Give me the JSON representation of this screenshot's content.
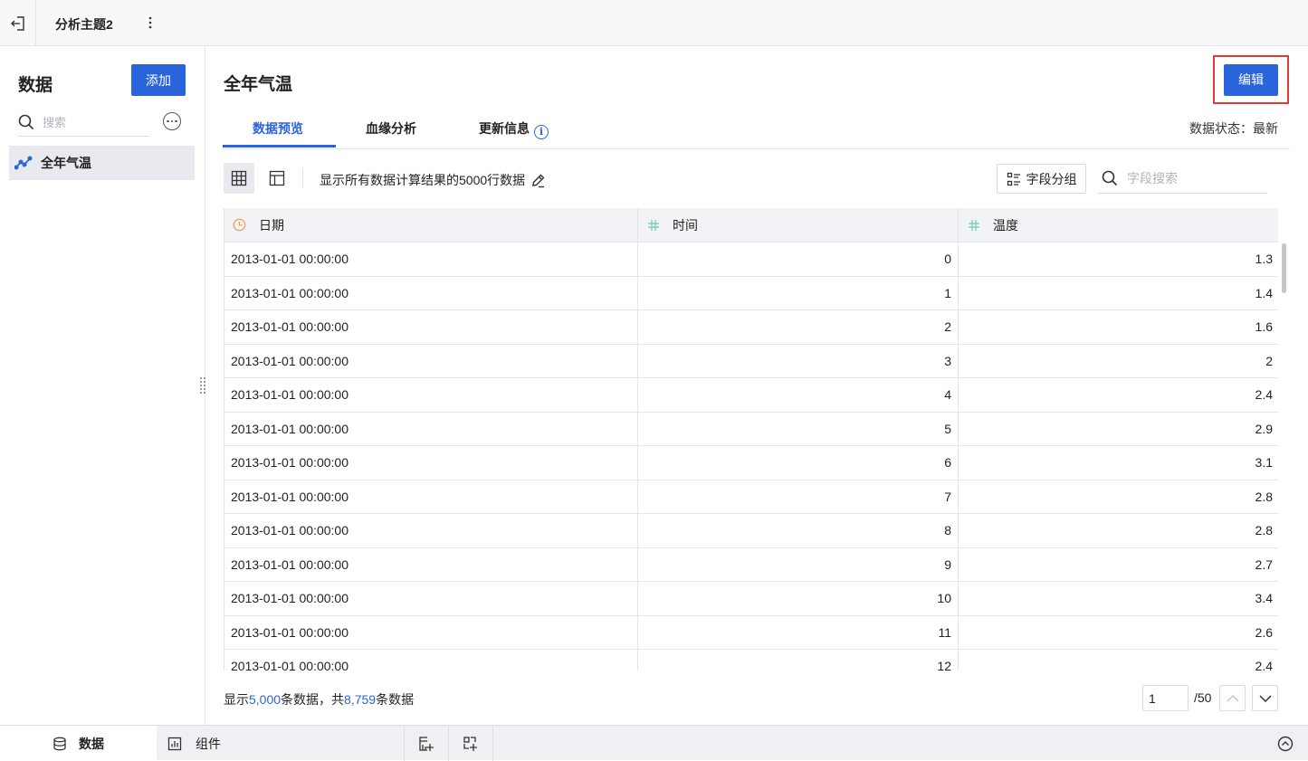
{
  "topbar": {
    "title": "分析主题2"
  },
  "sidebar": {
    "title": "数据",
    "add_label": "添加",
    "search_placeholder": "搜索",
    "items": [
      {
        "label": "全年气温"
      }
    ]
  },
  "main": {
    "title": "全年气温",
    "edit_label": "编辑",
    "tabs": [
      {
        "label": "数据预览"
      },
      {
        "label": "血缘分析"
      },
      {
        "label": "更新信息"
      }
    ],
    "status": "数据状态：最新",
    "toolbar": {
      "info_text": "显示所有数据计算结果的5000行数据",
      "group_label": "字段分组",
      "field_search_placeholder": "字段搜索"
    },
    "table": {
      "columns": [
        "日期",
        "时间",
        "温度"
      ],
      "rows": [
        [
          "2013-01-01 00:00:00",
          "0",
          "1.3"
        ],
        [
          "2013-01-01 00:00:00",
          "1",
          "1.4"
        ],
        [
          "2013-01-01 00:00:00",
          "2",
          "1.6"
        ],
        [
          "2013-01-01 00:00:00",
          "3",
          "2"
        ],
        [
          "2013-01-01 00:00:00",
          "4",
          "2.4"
        ],
        [
          "2013-01-01 00:00:00",
          "5",
          "2.9"
        ],
        [
          "2013-01-01 00:00:00",
          "6",
          "3.1"
        ],
        [
          "2013-01-01 00:00:00",
          "7",
          "2.8"
        ],
        [
          "2013-01-01 00:00:00",
          "8",
          "2.8"
        ],
        [
          "2013-01-01 00:00:00",
          "9",
          "2.7"
        ],
        [
          "2013-01-01 00:00:00",
          "10",
          "3.4"
        ],
        [
          "2013-01-01 00:00:00",
          "11",
          "2.6"
        ],
        [
          "2013-01-01 00:00:00",
          "12",
          "2.4"
        ]
      ]
    },
    "footer": {
      "prefix": "显示",
      "shown": "5,000",
      "mid": "条数据，共",
      "total": "8,759",
      "suffix": "条数据",
      "page": "1",
      "page_total": "/50"
    }
  },
  "bottombar": {
    "tabs": [
      {
        "label": "数据"
      },
      {
        "label": "组件"
      }
    ]
  },
  "colors": {
    "accent": "#2a64dc",
    "highlight_border": "#e53935",
    "date_icon": "#f0a35b",
    "number_icon": "#7fcfc0"
  }
}
